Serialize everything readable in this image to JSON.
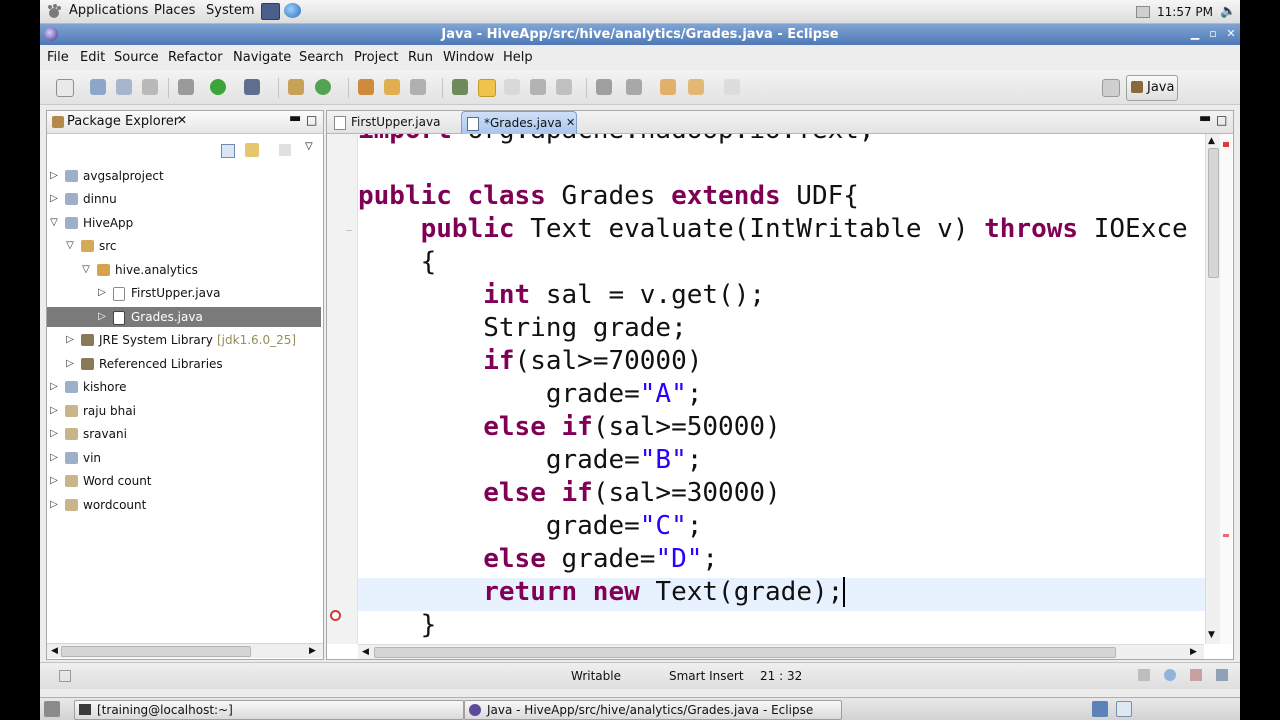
{
  "panel": {
    "applications": "Applications",
    "places": "Places",
    "system": "System",
    "time": "11:57 PM"
  },
  "window": {
    "title": "Java - HiveApp/src/hive/analytics/Grades.java - Eclipse"
  },
  "menubar": {
    "items": [
      "File",
      "Edit",
      "Source",
      "Refactor",
      "Navigate",
      "Search",
      "Project",
      "Run",
      "Window",
      "Help"
    ]
  },
  "perspective": {
    "label": "Java"
  },
  "package_explorer": {
    "title": "Package Explorer",
    "tree": [
      {
        "label": "avgsalproject",
        "expanded": false
      },
      {
        "label": "dinnu",
        "expanded": false
      },
      {
        "label": "HiveApp",
        "expanded": true
      },
      {
        "label": "src",
        "expanded": true
      },
      {
        "label": "hive.analytics",
        "expanded": true
      },
      {
        "label": "FirstUpper.java",
        "expanded": false
      },
      {
        "label": "Grades.java",
        "expanded": false,
        "selected": true
      },
      {
        "label": "JRE System Library",
        "decoration": "[jdk1.6.0_25]",
        "expanded": false
      },
      {
        "label": "Referenced Libraries",
        "expanded": false
      },
      {
        "label": "kishore",
        "expanded": false
      },
      {
        "label": "raju bhai",
        "expanded": false
      },
      {
        "label": "sravani",
        "expanded": false
      },
      {
        "label": "vin",
        "expanded": false
      },
      {
        "label": "Word count",
        "expanded": false
      },
      {
        "label": "wordcount",
        "expanded": false
      }
    ]
  },
  "editor": {
    "tabs": [
      {
        "label": "FirstUpper.java",
        "active": false
      },
      {
        "label": "*Grades.java",
        "active": true
      }
    ],
    "code_lines": [
      "import org.apache.hadoop.io.Text;",
      "",
      "public class Grades extends UDF{",
      "    public Text evaluate(IntWritable v) throws IOExce",
      "    {",
      "        int sal = v.get();",
      "        String grade;",
      "        if(sal>=70000)",
      "            grade=\"A\";",
      "        else if(sal>=50000)",
      "            grade=\"B\";",
      "        else if(sal>=30000)",
      "            grade=\"C\";",
      "        else grade=\"D\";",
      "        return new Text(grade);",
      "    }"
    ]
  },
  "status": {
    "writable": "Writable",
    "insert_mode": "Smart Insert",
    "position": "21 : 32"
  },
  "taskbar": {
    "terminal": "[training@localhost:~]",
    "eclipse": "Java - HiveApp/src/hive/analytics/Grades.java - Eclipse"
  },
  "colors": {
    "keyword": "#7f0055",
    "string": "#2a00ff",
    "selection": "#7a7a7a",
    "titlebar": "#5a84c0"
  }
}
